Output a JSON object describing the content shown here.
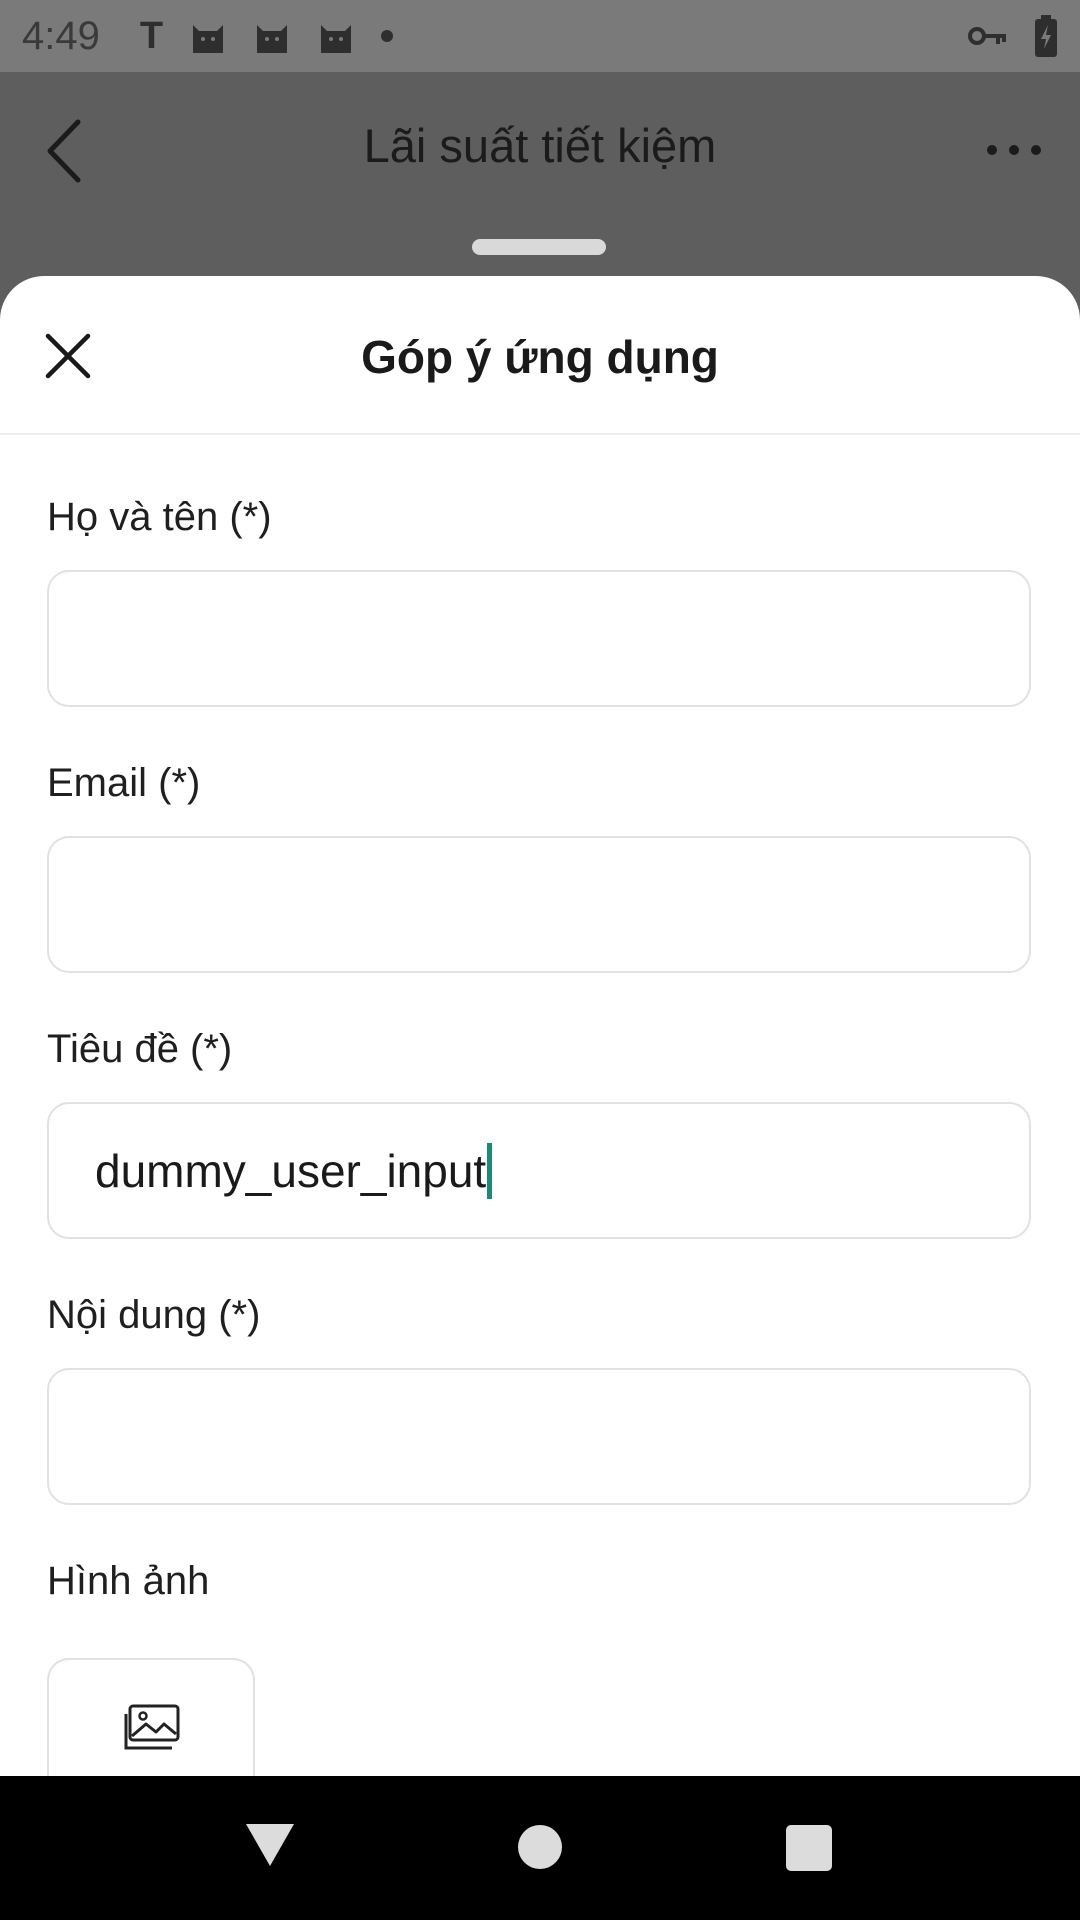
{
  "status_bar": {
    "time": "4:49",
    "left_icons": [
      "text-t-icon",
      "cat-icon",
      "cat-icon",
      "cat-icon",
      "dot-icon"
    ],
    "right_icons": [
      "vpn-key-icon",
      "battery-charging-icon"
    ],
    "t_glyph": "T"
  },
  "background_app": {
    "title": "Lãi suất tiết kiệm"
  },
  "sheet": {
    "title": "Góp ý ứng dụng",
    "fields": [
      {
        "label": "Họ và tên (*)",
        "value": ""
      },
      {
        "label": "Email (*)",
        "value": ""
      },
      {
        "label": "Tiêu đề (*)",
        "value": "dummy_user_input"
      },
      {
        "label": "Nội dung (*)",
        "value": ""
      }
    ],
    "image_label": "Hình ảnh"
  },
  "colors": {
    "caret": "#1a8a74",
    "dim_overlay": "#5e5e5e"
  }
}
